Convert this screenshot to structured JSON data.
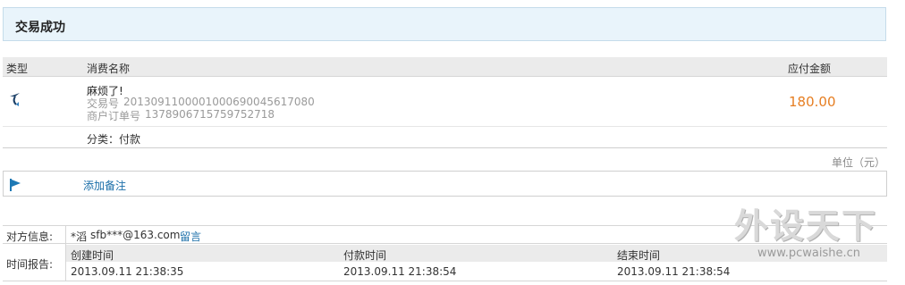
{
  "header": {
    "title": "交易成功"
  },
  "table": {
    "columns": {
      "type": "类型",
      "name": "消费名称",
      "amount": "应付金额"
    },
    "item": {
      "name": "麻烦了!",
      "trade_no_label": "交易号",
      "trade_no": "2013091100001000690045617080",
      "merchant_order_label": "商户订单号",
      "merchant_order_no": "1378906715759752718",
      "amount": "180.00",
      "category_label": "分类：",
      "category_value": "付款"
    },
    "unit": "单位（元）"
  },
  "note": {
    "add_label": "添加备注"
  },
  "counterparty": {
    "label": "对方信息:",
    "name": "*滔",
    "email": "sfb***@163.com",
    "message_link": "留言"
  },
  "time_report": {
    "label": "时间报告:",
    "created_label": "创建时间",
    "created_value": "2013.09.11 21:38:35",
    "paid_label": "付款时间",
    "paid_value": "2013.09.11 21:38:54",
    "ended_label": "结束时间",
    "ended_value": "2013.09.11 21:38:54"
  },
  "watermark": {
    "text": "外设天下",
    "url": "www.pcwaishe.cn"
  },
  "colors": {
    "accent_link": "#1a6ea8",
    "amount": "#e67e22",
    "title_bg": "#e9f4fb"
  }
}
